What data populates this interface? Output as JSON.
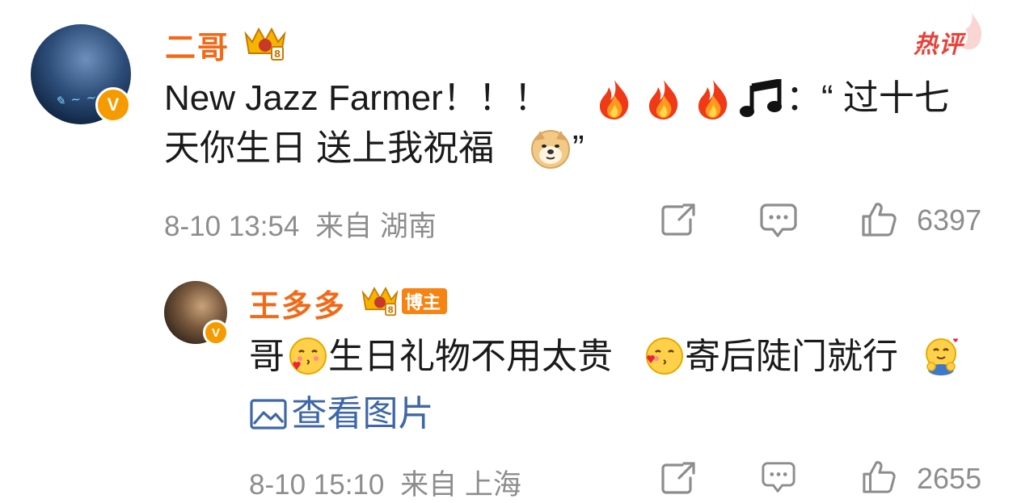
{
  "comment1": {
    "author": "二哥",
    "hot_tag": "热评",
    "text_line1": "New Jazz Farmer！！！",
    "text_quote_start": "：“ 过十七",
    "text_line2": "天你生日 送上我祝福",
    "text_quote_end": "”",
    "date": "8-10 13:54",
    "location": "来自 湖南",
    "likes": "6397"
  },
  "reply1": {
    "author": "王多多",
    "badge": "博主",
    "text_part1": "哥",
    "text_part2": "生日礼物不用太贵",
    "text_part3": "寄后陡门就行",
    "view_image": "查看图片",
    "date": "8-10 15:10",
    "location": "来自 上海",
    "likes": "2655"
  },
  "colors": {
    "name": "#f26a18",
    "hot": "#e8423a",
    "link": "#3e67a8",
    "meta": "#8d8d8d"
  },
  "icons": [
    "share-icon",
    "comment-icon",
    "like-icon",
    "fire-emoji",
    "music-note-emoji",
    "doge-emoji",
    "crown-badge-icon",
    "verified-v-icon"
  ]
}
